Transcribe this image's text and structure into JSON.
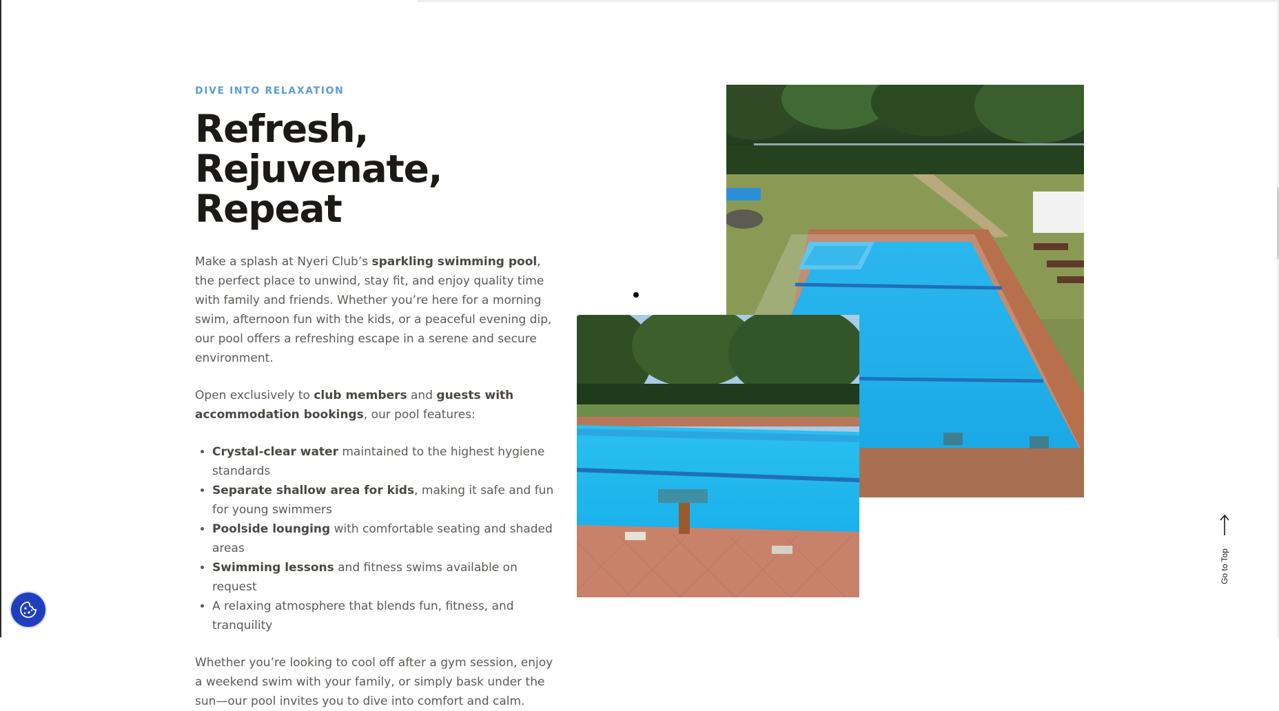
{
  "section": {
    "eyebrow": "DIVE INTO RELAXATION",
    "title_line1": "Refresh,",
    "title_line2": "Rejuvenate, Repeat",
    "intro": {
      "p1_a": "Make a splash at Nyeri Club’s ",
      "p1_b": "sparkling swimming pool",
      "p1_c": ", the perfect place to unwind, stay fit, and enjoy quality time with family and friends. Whether you’re here for a morning swim, afternoon fun with the kids, or a peaceful evening dip, our pool offers a refreshing escape in a serene and secure environment."
    },
    "access": {
      "a": "Open exclusively to ",
      "b": "club members",
      "c": " and ",
      "d": "guests with accommodation bookings",
      "e": ", our pool features:"
    },
    "features": [
      {
        "bold": "Crystal-clear water",
        "text": " maintained to the highest hygiene standards"
      },
      {
        "bold": "Separate shallow area for kids",
        "text": ", making it safe and fun for young swimmers"
      },
      {
        "bold": "Poolside lounging",
        "text": " with comfortable seating and shaded areas"
      },
      {
        "bold": "Swimming lessons",
        "text": " and fitness swims available on request"
      },
      {
        "bold": "",
        "text": "A relaxing atmosphere that blends fun, fitness, and tranquility"
      }
    ],
    "closing": "Whether you’re looking to cool off after a gym session, enjoy a weekend swim with your family, or simply bask under the sun—our pool invites you to dive into comfort and calm."
  },
  "images": {
    "back": "pool-aerial-photo",
    "front": "pool-starting-block-photo"
  },
  "nav": {
    "go_top_label": "Go to Top",
    "go_top_icon": "arrow-up-icon"
  },
  "cookie": {
    "icon": "cookie-icon",
    "color": "#1f3fbf"
  },
  "colors": {
    "eyebrow": "#5a9fd4",
    "heading": "#1c1a16",
    "body": "#5d5a56"
  }
}
